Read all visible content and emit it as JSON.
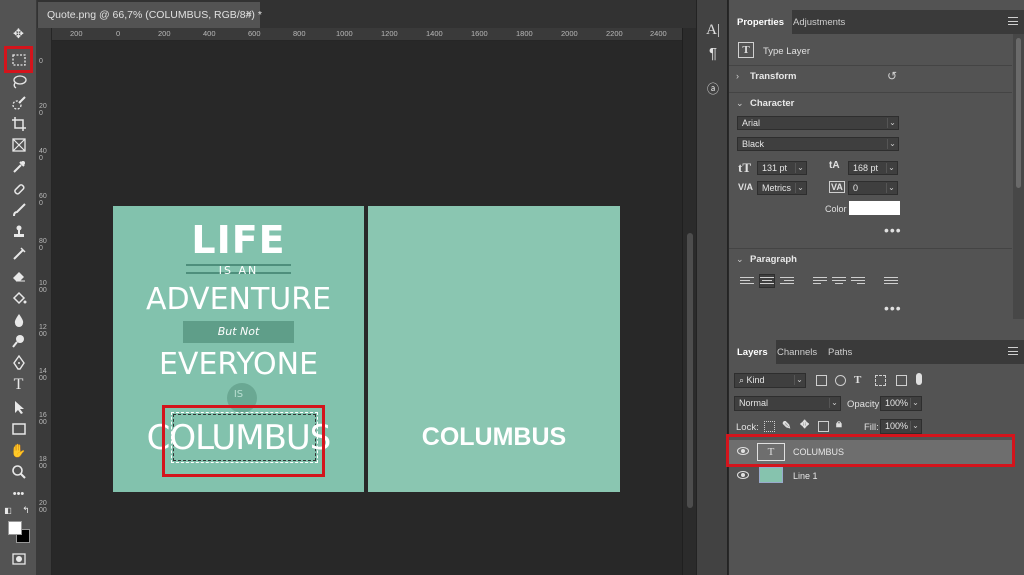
{
  "document": {
    "tab_title": "Quote.png @ 66,7% (COLUMBUS, RGB/8#) *",
    "close": "×"
  },
  "rulers": {
    "top": [
      "200",
      "0",
      "200",
      "400",
      "600",
      "800",
      "1000",
      "1200",
      "1400",
      "1600",
      "1800",
      "2000",
      "2200",
      "2400"
    ],
    "left": [
      "0",
      "200",
      "400",
      "600",
      "800",
      "1000",
      "1200",
      "1400",
      "1600",
      "1800",
      "2000"
    ]
  },
  "poster": {
    "line1": "LIFE",
    "line2": "IS AN",
    "line3": "ADVENTURE",
    "line4": "But Not",
    "line5": "EVERYONE",
    "line6": "IS",
    "line7": "COLUMBUS"
  },
  "right_artboard": {
    "text": "COLUMBUS"
  },
  "properties": {
    "tabs": [
      "Properties",
      "Adjustments"
    ],
    "layer_kind": "Type Layer",
    "transform_label": "Transform",
    "character_label": "Character",
    "font_family": "Arial",
    "font_style": "Black",
    "font_size": "131 pt",
    "leading": "168 pt",
    "kerning": "Metrics",
    "tracking": "0",
    "color_label": "Color",
    "more": "•••",
    "paragraph_label": "Paragraph"
  },
  "layers": {
    "tabs": [
      "Layers",
      "Channels",
      "Paths"
    ],
    "filter_kind": "Kind",
    "blend_mode": "Normal",
    "opacity_label": "Opacity:",
    "opacity_value": "100%",
    "lock_label": "Lock:",
    "fill_label": "Fill:",
    "fill_value": "100%",
    "items": [
      {
        "name": "COLUMBUS",
        "type": "text"
      },
      {
        "name": "Line 1",
        "type": "image"
      }
    ]
  },
  "colors": {
    "highlight": "#d4141c",
    "artboard": "#88c5b0"
  }
}
